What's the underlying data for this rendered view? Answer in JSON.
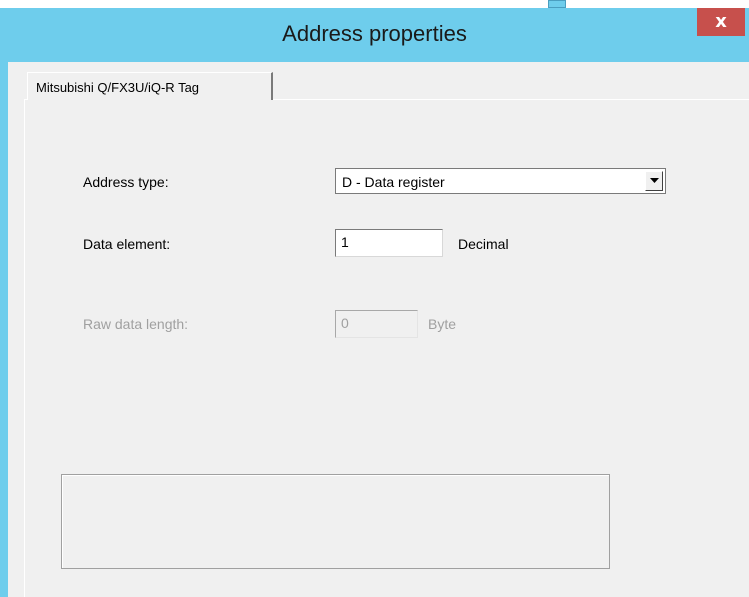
{
  "window": {
    "title": "Address properties",
    "close_label": "x"
  },
  "tabs": [
    {
      "label": "Mitsubishi Q/FX3U/iQ-R Tag",
      "active": true
    }
  ],
  "form": {
    "address_type": {
      "label": "Address type:",
      "selected": "D - Data register"
    },
    "data_element": {
      "label": "Data element:",
      "value": "1",
      "unit": "Decimal"
    },
    "raw_data_length": {
      "label": "Raw data length:",
      "value": "0",
      "unit": "Byte",
      "enabled": false
    }
  },
  "icons": {
    "close": "close-icon",
    "dropdown": "chevron-down-icon"
  },
  "colors": {
    "frame": "#6ecdec",
    "close_button": "#c7504c",
    "client_background": "#f0f0f0",
    "disabled_text": "#a0a0a0"
  }
}
